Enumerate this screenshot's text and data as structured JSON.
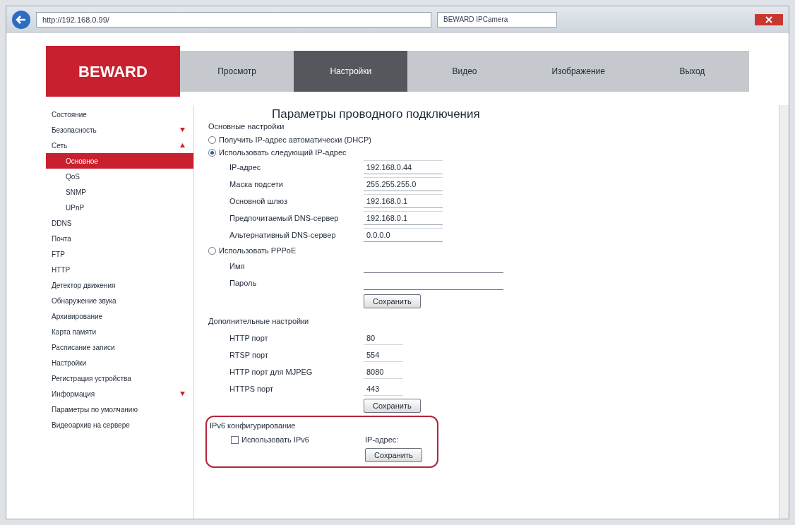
{
  "browser": {
    "address": "http://192.168.0.99/",
    "tab_title": "BEWARD IPCamera"
  },
  "logo": "BEWARD",
  "nav": [
    {
      "label": "Просмотр",
      "selected": false
    },
    {
      "label": "Настройки",
      "selected": true
    },
    {
      "label": "Видео",
      "selected": false
    },
    {
      "label": "Изображение",
      "selected": false
    },
    {
      "label": "Выход",
      "selected": false
    }
  ],
  "sidebar": [
    {
      "label": "Состояние",
      "selected": false
    },
    {
      "label": "Безопасность",
      "selected": false,
      "expanded": false
    },
    {
      "label": "Сеть",
      "selected": false,
      "expanded": true,
      "children": [
        {
          "label": "Основное",
          "selected": true
        },
        {
          "label": "QoS",
          "selected": false
        },
        {
          "label": "SNMP",
          "selected": false
        },
        {
          "label": "UPnP",
          "selected": false
        }
      ]
    },
    {
      "label": "DDNS",
      "selected": false
    },
    {
      "label": "Почта",
      "selected": false
    },
    {
      "label": "FTP",
      "selected": false
    },
    {
      "label": "HTTP",
      "selected": false
    },
    {
      "label": "Детектор движения",
      "selected": false
    },
    {
      "label": "Обнаружение звука",
      "selected": false
    },
    {
      "label": "Архивирование",
      "selected": false
    },
    {
      "label": "Карта памяти",
      "selected": false
    },
    {
      "label": "Расписание записи",
      "selected": false
    },
    {
      "label": "Настройки",
      "selected": false
    },
    {
      "label": "Регистрация устройства",
      "selected": false
    },
    {
      "label": "Информация",
      "selected": false,
      "expanded": false
    },
    {
      "label": "Параметры по умолчанию",
      "selected": false
    },
    {
      "label": "Видеоархив на сервере",
      "selected": false
    }
  ],
  "title": "Параметры проводного подключения",
  "basic": {
    "heading": "Основные настройки",
    "dhcp": {
      "label": "Получить IP-адрес автоматически (DHCP)",
      "selected": false
    },
    "static": {
      "label": "Использовать следующий IP-адрес",
      "selected": true
    },
    "fields": [
      {
        "label": "IP-адрес",
        "value": "192.168.0.44"
      },
      {
        "label": "Маска подсети",
        "value": "255.255.255.0"
      },
      {
        "label": "Основной шлюз",
        "value": "192.168.0.1"
      },
      {
        "label": "Предпочитаемый DNS-сервер",
        "value": "192.168.0.1"
      },
      {
        "label": "Альтернативный DNS-сервер",
        "value": "0.0.0.0"
      }
    ],
    "pppoe": {
      "label": "Использовать PPPoE",
      "selected": false
    },
    "pppoe_fields": [
      {
        "label": "Имя"
      },
      {
        "label": "Пароль"
      }
    ],
    "button": "Сохранить"
  },
  "advanced": {
    "heading": "Дополнительные настройки",
    "fields": [
      {
        "label": "HTTP порт",
        "value": "80"
      },
      {
        "label": "RTSP порт",
        "value": "554"
      },
      {
        "label": "HTTP порт для MJPEG",
        "value": "8080"
      },
      {
        "label": "HTTPS порт",
        "value": "443"
      }
    ],
    "button": "Сохранить"
  },
  "ipv6": {
    "heading": "IPv6 конфигурирование",
    "checkbox": {
      "label": "Использовать IPv6",
      "checked": false
    },
    "ip_label": "IP-адрес:",
    "button": "Сохранить"
  }
}
